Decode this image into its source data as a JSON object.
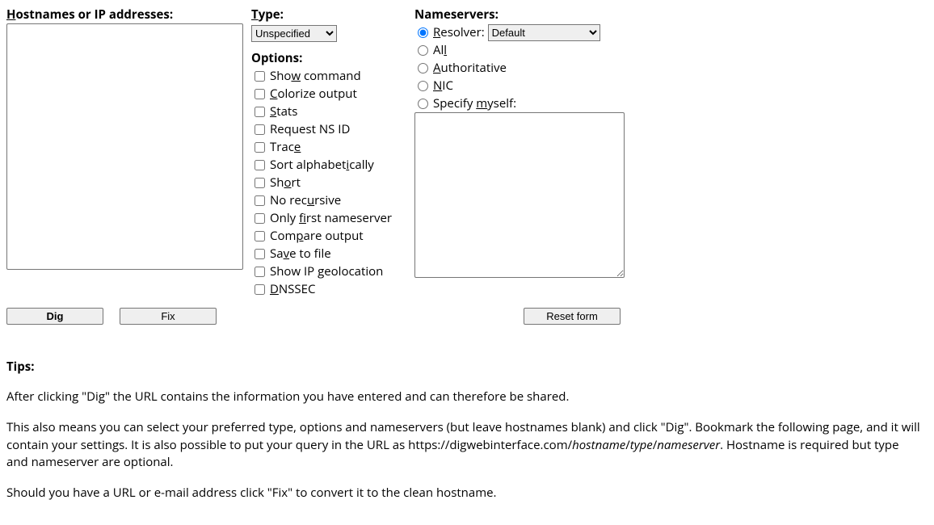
{
  "headings": {
    "hostnames_pre": "H",
    "hostnames_post": "ostnames or IP addresses:",
    "type_pre": "T",
    "type_post": "ype:",
    "options": "Options:",
    "nameservers": "Nameservers:"
  },
  "type": {
    "selected": "Unspecified"
  },
  "options": [
    {
      "pre": "Sho",
      "u": "w",
      "post": " command"
    },
    {
      "pre": "",
      "u": "C",
      "post": "olorize output"
    },
    {
      "pre": "",
      "u": "S",
      "post": "tats"
    },
    {
      "pre": "Request NS ID",
      "u": "",
      "post": ""
    },
    {
      "pre": "Trac",
      "u": "e",
      "post": ""
    },
    {
      "pre": "Sort alphabet",
      "u": "i",
      "post": "cally"
    },
    {
      "pre": "Sh",
      "u": "o",
      "post": "rt"
    },
    {
      "pre": "No rec",
      "u": "u",
      "post": "rsive"
    },
    {
      "pre": "Only ",
      "u": "fi",
      "post": "rst nameserver"
    },
    {
      "pre": "Com",
      "u": "p",
      "post": "are output"
    },
    {
      "pre": "Sa",
      "u": "v",
      "post": "e to file"
    },
    {
      "pre": "Show IP geolocation",
      "u": "",
      "post": ""
    },
    {
      "pre": "",
      "u": "D",
      "post": "NSSEC"
    }
  ],
  "ns": {
    "resolver_pre": "R",
    "resolver_post": "esolver:",
    "resolver_select": "Default",
    "all_pre": "Al",
    "all_u": "l",
    "all_post": "",
    "auth_pre": "",
    "auth_u": "A",
    "auth_post": "uthoritative",
    "nic_pre": "",
    "nic_u": "N",
    "nic_post": "IC",
    "myself_pre": "Specify ",
    "myself_u": "m",
    "myself_post": "yself:"
  },
  "buttons": {
    "dig": "Dig",
    "fix": "Fix",
    "reset": "Reset form"
  },
  "tips": {
    "heading": "Tips:",
    "p1": "After clicking \"Dig\" the URL contains the information you have entered and can therefore be shared.",
    "p2a": "This also means you can select your preferred type, options and nameservers (but leave hostnames blank) and click \"Dig\". Bookmark the following page, and it will contain your settings. It is also possible to put your query in the URL as https://digwebinterface.com/",
    "p2b_host": "hostname",
    "p2b_s1": "/",
    "p2b_type": "type",
    "p2b_s2": "/",
    "p2b_ns": "nameserver",
    "p2c": ". Hostname is required but type and nameserver are optional.",
    "p3": "Should you have a URL or e-mail address click \"Fix\" to convert it to the clean hostname."
  }
}
